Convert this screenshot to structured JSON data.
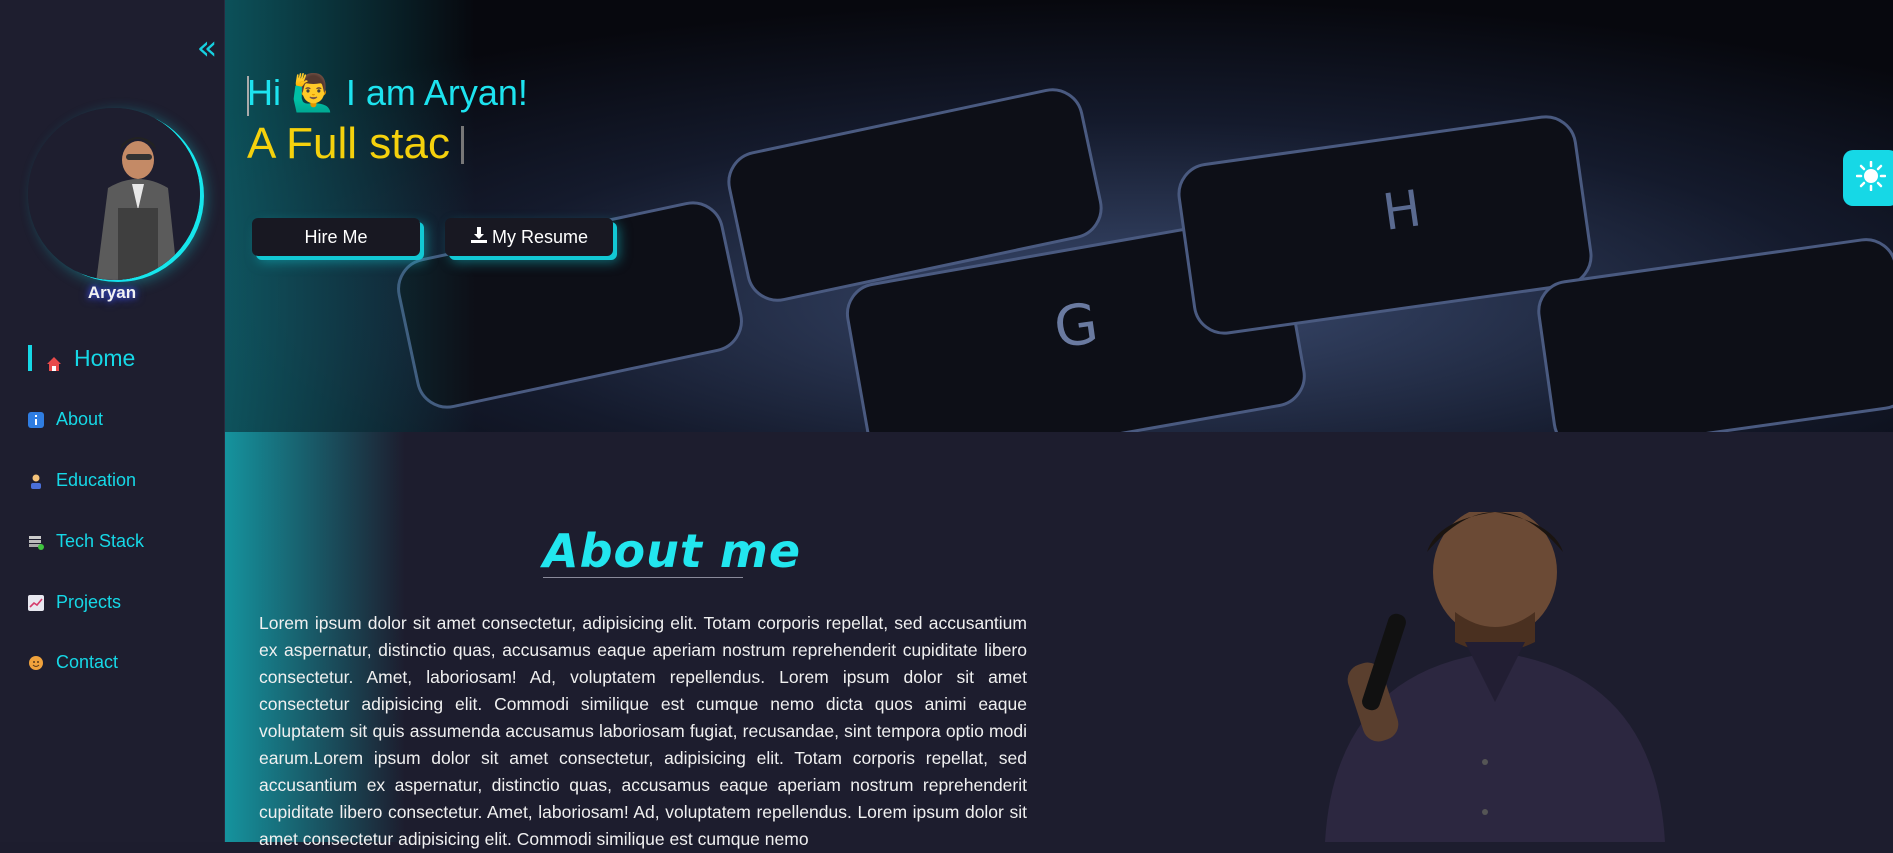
{
  "sidebar": {
    "collapse_icon": "double-chevron-left-icon",
    "profile_name": "Aryan",
    "items": [
      {
        "label": "Home",
        "icon": "house-icon",
        "active": true
      },
      {
        "label": "About",
        "icon": "info-icon"
      },
      {
        "label": "Education",
        "icon": "student-icon"
      },
      {
        "label": "Tech Stack",
        "icon": "server-icon"
      },
      {
        "label": "Projects",
        "icon": "chart-icon"
      },
      {
        "label": "Contact",
        "icon": "person-icon"
      }
    ]
  },
  "hero": {
    "greeting_prefix": "Hi",
    "greeting_emoji": "🙋‍♂️",
    "greeting_suffix": "I am Aryan!",
    "typing_text": "A Full stac",
    "hire_label": "Hire Me",
    "resume_label": "My Resume"
  },
  "theme_toggle": {
    "icon": "sun-icon"
  },
  "about": {
    "title": "About me",
    "paragraph": "Lorem ipsum dolor sit amet consectetur, adipisicing elit. Totam corporis repellat, sed accusantium ex aspernatur, distinctio quas, accusamus eaque aperiam nostrum reprehenderit cupiditate libero consectetur. Amet, laboriosam! Ad, voluptatem repellendus. Lorem ipsum dolor sit amet consectetur adipisicing elit. Commodi similique est cumque nemo dicta quos animi eaque voluptatem sit quis assumenda accusamus laboriosam fugiat, recusandae, sint tempora optio modi earum.Lorem ipsum dolor sit amet consectetur, adipisicing elit. Totam corporis repellat, sed accusantium ex aspernatur, distinctio quas, accusamus eaque aperiam nostrum reprehenderit cupiditate libero consectetur. Amet, laboriosam! Ad, voluptatem repellendus. Lorem ipsum dolor sit amet consectetur adipisicing elit. Commodi similique est cumque nemo"
  },
  "colors": {
    "accent": "#16d8e6",
    "typing": "#f5d10c",
    "background": "#1d1d2e"
  }
}
